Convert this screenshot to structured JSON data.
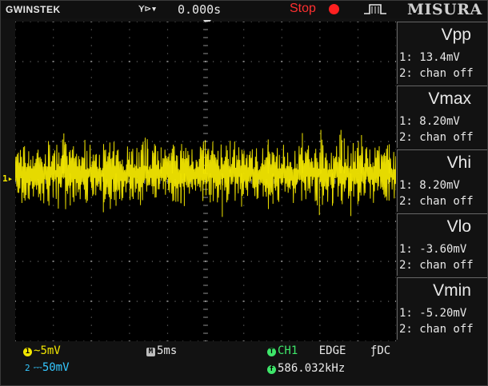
{
  "topbar": {
    "brand": "GWINSTEK",
    "trigger_arrows": "⋎⊳▾",
    "trigger_position": "0.000s",
    "run_status": "Stop",
    "trigger_icon": "rising-edge-trigger-icon",
    "watermark": "MISURA"
  },
  "channel1_marker": "1▸",
  "measurements": [
    {
      "title": "Vpp",
      "ch1": "1: 13.4mV",
      "ch2": "2: chan off"
    },
    {
      "title": "Vmax",
      "ch1": "1: 8.20mV",
      "ch2": "2: chan off"
    },
    {
      "title": "Vhi",
      "ch1": "1: 8.20mV",
      "ch2": "2: chan off"
    },
    {
      "title": "Vlo",
      "ch1": "1: -3.60mV",
      "ch2": "2: chan off"
    },
    {
      "title": "Vmin",
      "ch1": "1: -5.20mV",
      "ch2": "2: chan off"
    }
  ],
  "bottom": {
    "ch1_badge": "1",
    "ch1_coupling": "~",
    "ch1_scale": "5mV",
    "ch2_badge": "2",
    "ch2_coupling": "⎓",
    "ch2_scale": "50mV",
    "timebase_badge": "M",
    "timebase": "5ms",
    "trigger_badge": "T",
    "trigger_source": "CH1",
    "trigger_type": "EDGE",
    "trigger_coupling": "ƒDC",
    "freq_badge": "f",
    "frequency": "586.032kHz"
  },
  "colors": {
    "ch1": "#f2e600",
    "ch2": "#35c8ff",
    "stop": "#ff2020",
    "trigger": "#3ee66a"
  }
}
